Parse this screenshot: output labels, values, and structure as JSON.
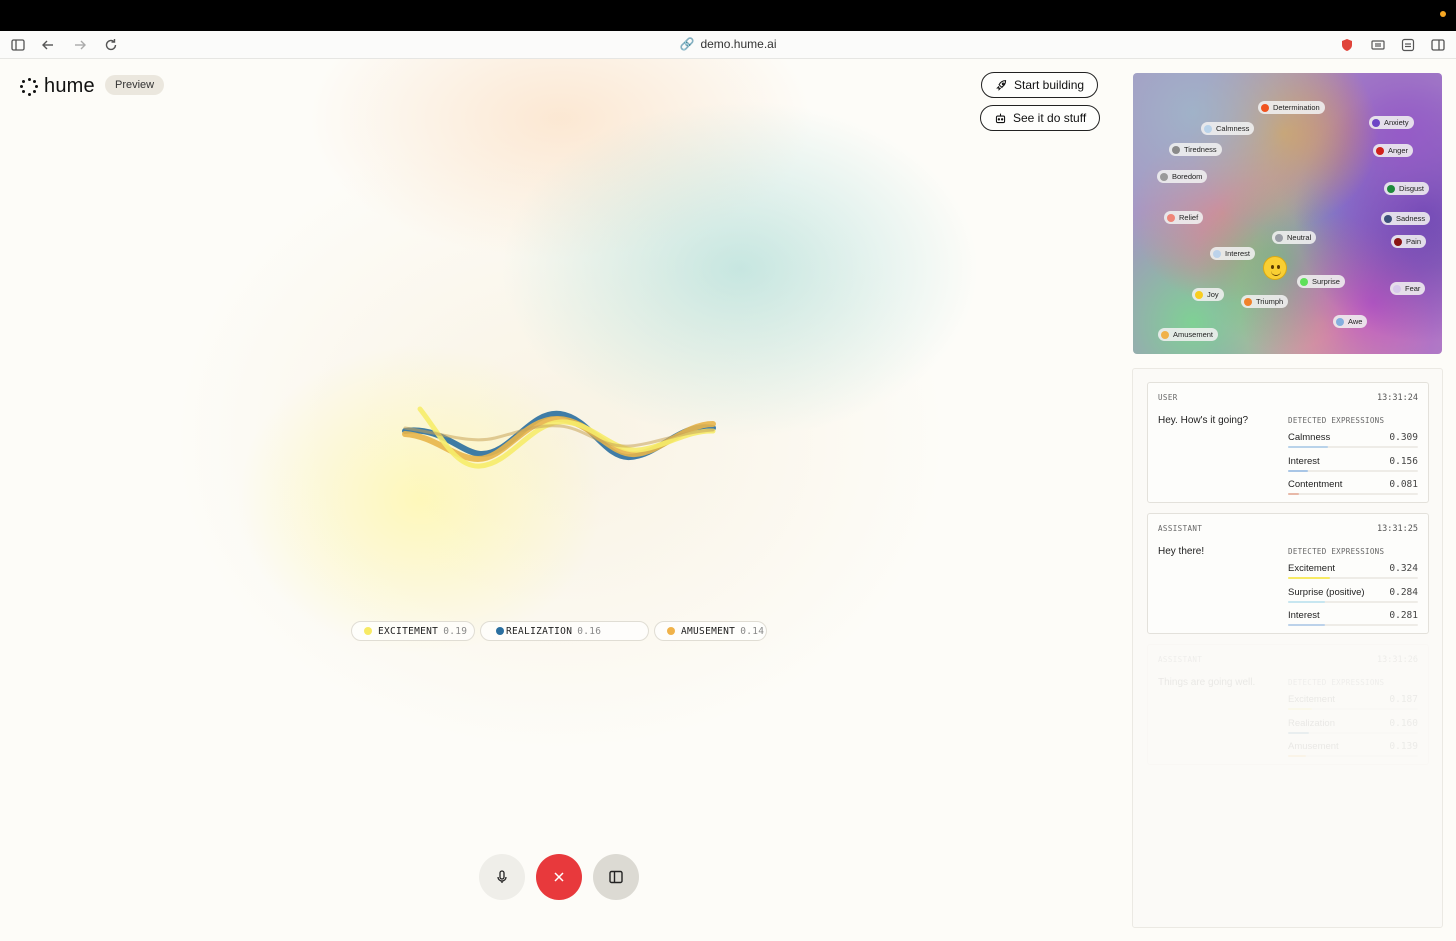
{
  "browser": {
    "url": "demo.hume.ai"
  },
  "header": {
    "brand": "hume",
    "badge": "Preview",
    "start_building": "Start building",
    "see_it_do_stuff": "See it do stuff"
  },
  "emotion_chips": [
    {
      "name": "EXCITEMENT",
      "value": "0.19",
      "color": "#f7ea64"
    },
    {
      "name": "REALIZATION",
      "value": "0.16",
      "color": "#2a6fa0"
    },
    {
      "name": "AMUSEMENT",
      "value": "0.14",
      "color": "#f0b24a"
    }
  ],
  "emotion_map": {
    "labels": [
      {
        "name": "Determination",
        "color": "#f0531f"
      },
      {
        "name": "Calmness",
        "color": "#b9d3ea"
      },
      {
        "name": "Anxiety",
        "color": "#6d46c6"
      },
      {
        "name": "Tiredness",
        "color": "#8a8a8a"
      },
      {
        "name": "Anger",
        "color": "#d0201b"
      },
      {
        "name": "Boredom",
        "color": "#9a9a9a"
      },
      {
        "name": "Disgust",
        "color": "#1f8a3c"
      },
      {
        "name": "Relief",
        "color": "#ef8578"
      },
      {
        "name": "Sadness",
        "color": "#3d4f7a"
      },
      {
        "name": "Neutral",
        "color": "#9a9ea6"
      },
      {
        "name": "Pain",
        "color": "#8a1414"
      },
      {
        "name": "Interest",
        "color": "#bcd2ea"
      },
      {
        "name": "Surprise",
        "color": "#5fe05a"
      },
      {
        "name": "Fear",
        "color": "#d8c9ec"
      },
      {
        "name": "Joy",
        "color": "#f8cd1f"
      },
      {
        "name": "Triumph",
        "color": "#f0822b"
      },
      {
        "name": "Awe",
        "color": "#84aede"
      },
      {
        "name": "Amusement",
        "color": "#f0b24a"
      }
    ]
  },
  "chat": {
    "detected_label": "DETECTED EXPRESSIONS",
    "messages": [
      {
        "role": "USER",
        "time": "13:31:24",
        "text": "Hey. How's it going?",
        "expressions": [
          {
            "name": "Calmness",
            "value": "0.309",
            "score": 0.309,
            "color": "#b9d3ea"
          },
          {
            "name": "Interest",
            "value": "0.156",
            "score": 0.156,
            "color": "#a9c6e6"
          },
          {
            "name": "Contentment",
            "value": "0.081",
            "score": 0.081,
            "color": "#e8b9a8"
          }
        ]
      },
      {
        "role": "ASSISTANT",
        "time": "13:31:25",
        "text": "Hey there!",
        "expressions": [
          {
            "name": "Excitement",
            "value": "0.324",
            "score": 0.324,
            "color": "#f7ea64"
          },
          {
            "name": "Surprise (positive)",
            "value": "0.284",
            "score": 0.284,
            "color": "#c7e6f0"
          },
          {
            "name": "Interest",
            "value": "0.281",
            "score": 0.281,
            "color": "#bcd2ea"
          }
        ]
      },
      {
        "role": "ASSISTANT",
        "time": "13:31:26",
        "text": "Things are going well.",
        "expressions": [
          {
            "name": "Excitement",
            "value": "0.187",
            "score": 0.187,
            "color": "#f7ea64"
          },
          {
            "name": "Realization",
            "value": "0.160",
            "score": 0.16,
            "color": "#2a6fa0"
          },
          {
            "name": "Amusement",
            "value": "0.139",
            "score": 0.139,
            "color": "#f0b24a"
          }
        ]
      }
    ]
  }
}
